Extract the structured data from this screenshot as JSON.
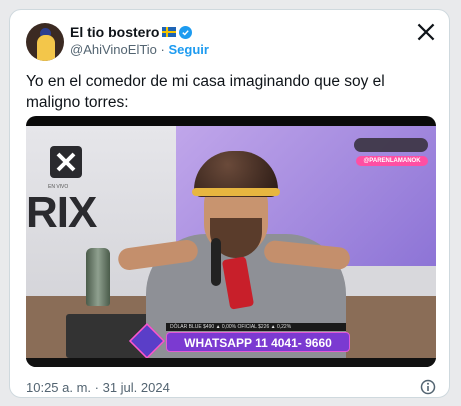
{
  "tweet": {
    "author_name": "El tio bostero",
    "author_handle": "@AhiVinoElTio",
    "follow_label": "Seguir",
    "text": "Yo en el comedor de mi casa imaginando que soy el maligno torres:",
    "timestamp": "10:25 a. m. · 31 jul. 2024"
  },
  "media": {
    "brand_text": "RIX",
    "live_label": "EN VIVO",
    "tv_handle": "@PARENLAMANOK",
    "ticker_text": "DÓLAR   BLUE $490  ▲ 0,00%   OFICIAL $226  ▲ 0,22%",
    "whatsapp_text": "WHATSAPP 11 4041- 9660"
  },
  "icons": {
    "x_logo": "x-logo-icon",
    "verified": "verified-badge-icon",
    "flag": "sweden-flag-icon",
    "info": "info-icon"
  },
  "colors": {
    "accent": "#1d9bf0",
    "text_primary": "#0f1419",
    "text_secondary": "#536471",
    "border": "#cfd9de"
  }
}
